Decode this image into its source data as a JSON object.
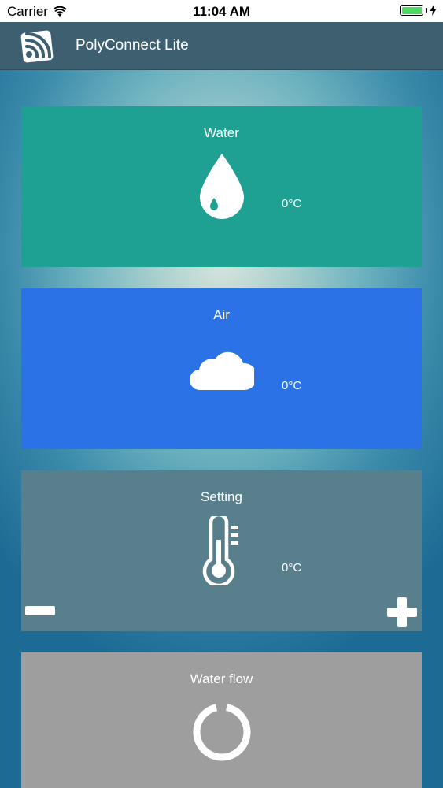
{
  "status_bar": {
    "carrier": "Carrier",
    "time": "11:04 AM",
    "battery_color": "#4cd964"
  },
  "header": {
    "title": "PolyConnect Lite",
    "logo_icon": "wifi-signal-logo-icon",
    "background": "#3e5f6f"
  },
  "cards": {
    "water": {
      "title": "Water",
      "value": "0°C",
      "icon": "water-drop-icon",
      "color": "#1ea093"
    },
    "air": {
      "title": "Air",
      "value": "0°C",
      "icon": "cloud-icon",
      "color": "#2a72e6"
    },
    "setting": {
      "title": "Setting",
      "value": "0°C",
      "icon": "thermometer-icon",
      "color": "#5a7f8c"
    },
    "flow": {
      "title": "Water flow",
      "icon": "power-ring-icon",
      "color": "#9e9e9e"
    }
  }
}
